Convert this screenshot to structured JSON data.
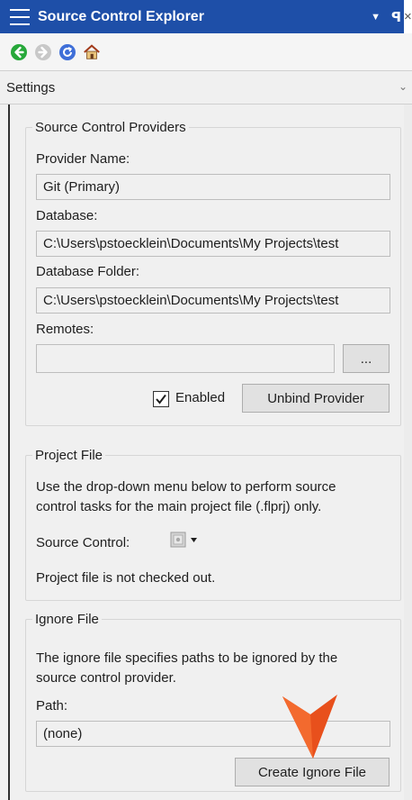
{
  "window": {
    "title": "Source Control Explorer",
    "dropdown_glyph": "▼",
    "pin_glyph": "ꟼ",
    "close_glyph": "×"
  },
  "toolbar": {
    "buttons": [
      "back-icon",
      "forward-icon",
      "refresh-icon",
      "home-icon"
    ]
  },
  "settings_dropdown": {
    "value": "Settings",
    "chevron": "⌄"
  },
  "providers": {
    "legend": "Source Control Providers",
    "provider_name_label": "Provider Name:",
    "provider_name_value": "Git (Primary)",
    "database_label": "Database:",
    "database_value": "C:\\Users\\pstoecklein\\Documents\\My Projects\\test",
    "database_folder_label": "Database Folder:",
    "database_folder_value": "C:\\Users\\pstoecklein\\Documents\\My Projects\\test",
    "remotes_label": "Remotes:",
    "remotes_value": "",
    "browse_label": "...",
    "enabled_label": "Enabled",
    "enabled_checked": true,
    "unbind_label": "Unbind Provider"
  },
  "project_file": {
    "legend": "Project File",
    "description_line1": "Use the drop-down menu below to perform source",
    "description_line2": "control tasks for the main project file (.flprj) only.",
    "source_control_label": "Source Control:",
    "status": "Project file is not checked out."
  },
  "ignore_file": {
    "legend": "Ignore File",
    "description_line1": "The ignore file specifies paths to be ignored by the",
    "description_line2": "source control provider.",
    "path_label": "Path:",
    "path_value": "(none)",
    "create_label": "Create Ignore File"
  },
  "colors": {
    "title_bar": "#1e4fa8",
    "panel": "#f0f0f0",
    "pointer": "#e8501c"
  }
}
